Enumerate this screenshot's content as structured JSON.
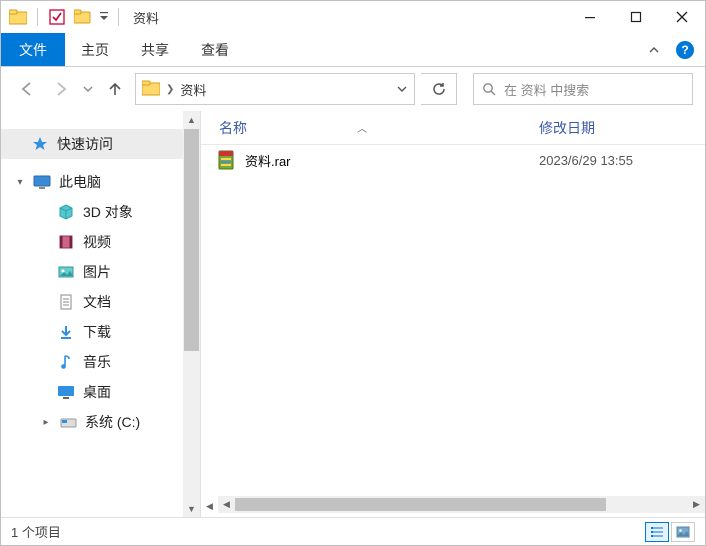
{
  "window": {
    "title": "资料"
  },
  "ribbon": {
    "file": "文件",
    "tabs": [
      "主页",
      "共享",
      "查看"
    ]
  },
  "nav": {
    "address_segment": "资料",
    "search_placeholder": "在 资料 中搜索"
  },
  "tree": {
    "quick_access": "快速访问",
    "this_pc": "此电脑",
    "children": [
      {
        "label": "3D 对象",
        "icon": "cube"
      },
      {
        "label": "视频",
        "icon": "film"
      },
      {
        "label": "图片",
        "icon": "picture"
      },
      {
        "label": "文档",
        "icon": "doc"
      },
      {
        "label": "下载",
        "icon": "download"
      },
      {
        "label": "音乐",
        "icon": "music"
      },
      {
        "label": "桌面",
        "icon": "desktop"
      },
      {
        "label": "系统 (C:)",
        "icon": "drive"
      }
    ]
  },
  "columns": {
    "name": "名称",
    "date": "修改日期"
  },
  "files": [
    {
      "name": "资料.rar",
      "date": "2023/6/29 13:55"
    }
  ],
  "status": {
    "text": "1 个项目"
  }
}
